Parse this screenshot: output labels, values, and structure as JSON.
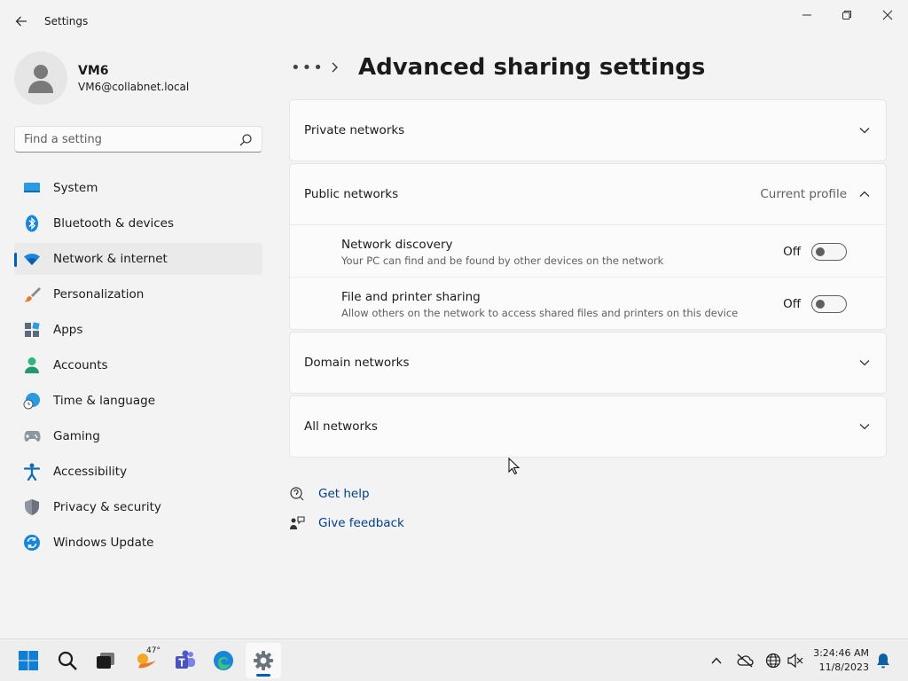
{
  "window": {
    "title": "Settings"
  },
  "profile": {
    "name": "VM6",
    "email": "VM6@collabnet.local"
  },
  "search": {
    "placeholder": "Find a setting"
  },
  "sidebar": {
    "items": [
      {
        "label": "System",
        "icon": "monitor-icon"
      },
      {
        "label": "Bluetooth & devices",
        "icon": "bluetooth-icon"
      },
      {
        "label": "Network & internet",
        "icon": "wifi-icon",
        "active": true
      },
      {
        "label": "Personalization",
        "icon": "brush-icon"
      },
      {
        "label": "Apps",
        "icon": "apps-icon"
      },
      {
        "label": "Accounts",
        "icon": "person-icon"
      },
      {
        "label": "Time & language",
        "icon": "globe-clock-icon"
      },
      {
        "label": "Gaming",
        "icon": "gamepad-icon"
      },
      {
        "label": "Accessibility",
        "icon": "accessibility-icon"
      },
      {
        "label": "Privacy & security",
        "icon": "shield-icon"
      },
      {
        "label": "Windows Update",
        "icon": "update-icon"
      }
    ]
  },
  "breadcrumb": {
    "more": "•••",
    "page_title": "Advanced sharing settings"
  },
  "sections": {
    "private": {
      "title": "Private networks"
    },
    "public": {
      "title": "Public networks",
      "extra": "Current profile",
      "rows": [
        {
          "title": "Network discovery",
          "desc": "Your PC can find and be found by other devices on the network",
          "state": "Off"
        },
        {
          "title": "File and printer sharing",
          "desc": "Allow others on the network to access shared files and printers on this device",
          "state": "Off"
        }
      ]
    },
    "domain": {
      "title": "Domain networks"
    },
    "all": {
      "title": "All networks"
    }
  },
  "links": {
    "help": "Get help",
    "feedback": "Give feedback"
  },
  "taskbar": {
    "weather_temp": "47°",
    "time": "3:24:46 AM",
    "date": "11/8/2023"
  },
  "colors": {
    "accent": "#005fb8",
    "link": "#003e92",
    "background": "#f3f3f3",
    "card": "#fbfbfb"
  }
}
